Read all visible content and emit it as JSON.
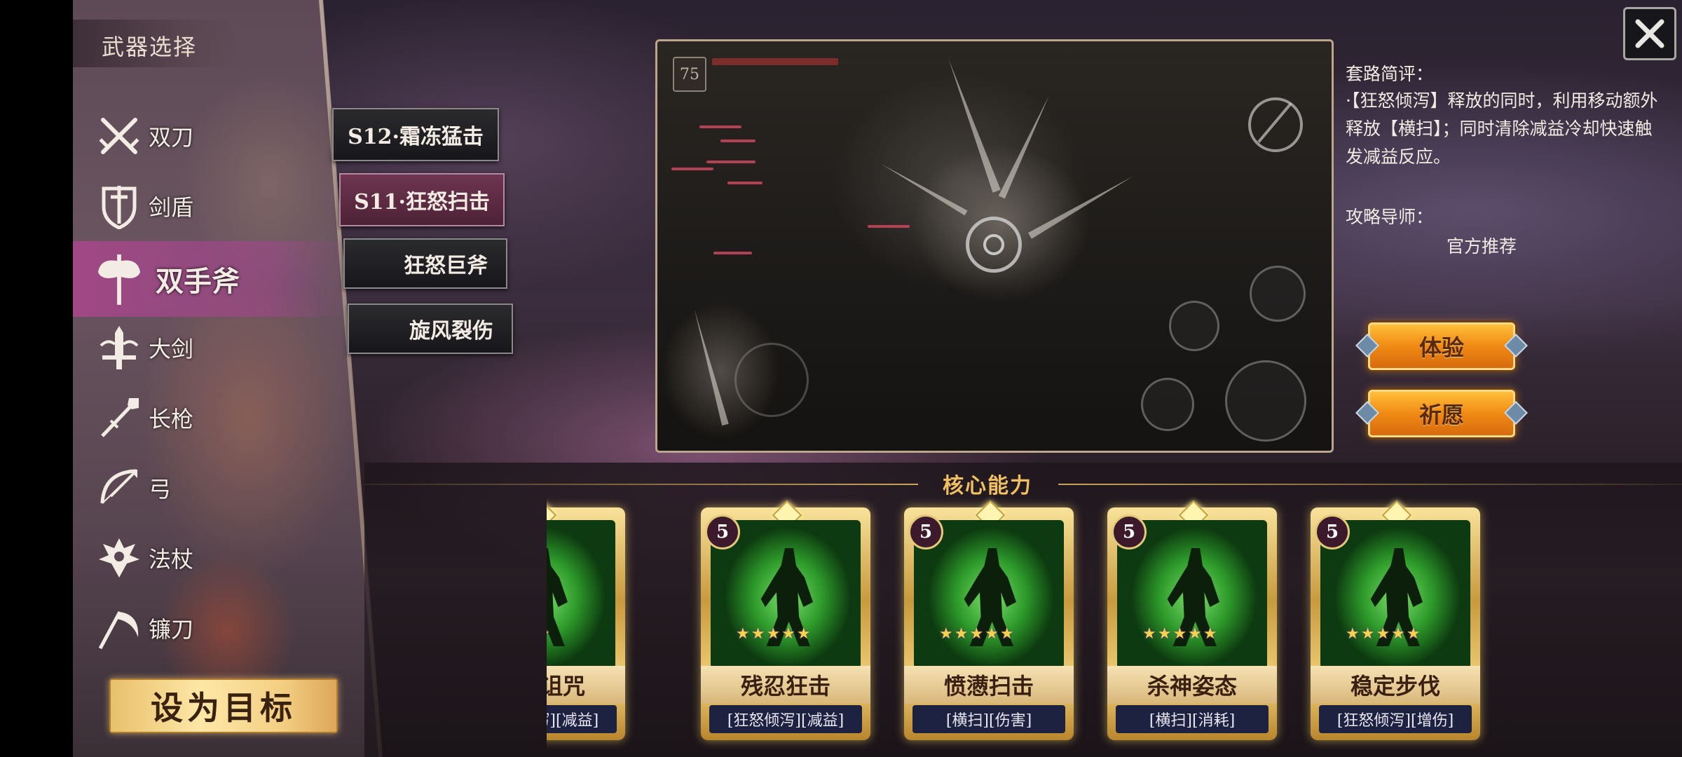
{
  "panel": {
    "title": "武器选择"
  },
  "weapons": [
    {
      "label": "双刀",
      "icon": "dual-blades-icon"
    },
    {
      "label": "剑盾",
      "icon": "sword-shield-icon"
    },
    {
      "label": "双手斧",
      "icon": "two-handed-axe-icon"
    },
    {
      "label": "大剑",
      "icon": "greatsword-icon"
    },
    {
      "label": "长枪",
      "icon": "spear-icon"
    },
    {
      "label": "弓",
      "icon": "bow-icon"
    },
    {
      "label": "法杖",
      "icon": "staff-icon"
    },
    {
      "label": "镰刀",
      "icon": "scythe-icon"
    }
  ],
  "selected_weapon": "双手斧",
  "set_target_label": "设为目标",
  "skill_tabs": [
    {
      "label": "S12·霜冻猛击"
    },
    {
      "label": "S11·狂怒扫击"
    },
    {
      "label": "狂怒巨斧"
    },
    {
      "label": "旋风裂伤"
    }
  ],
  "selected_tab": "S11·狂怒扫击",
  "preview": {
    "level": "75"
  },
  "info": {
    "review_title": "套路简评：",
    "review_text": "·【狂怒倾泻】释放的同时，利用移动额外释放【横扫】；同时清除减益冷却快速触发减益反应。",
    "mentor_title": "攻略导师：",
    "mentor_name": "官方推荐"
  },
  "buttons": {
    "experience": "体验",
    "pray": "祈愿"
  },
  "core": {
    "title": "核心能力",
    "cards": [
      {
        "name": "狂怒诅咒",
        "tags": "[狂怒倾泻][减益]",
        "level": "",
        "stars": "★★★★"
      },
      {
        "name": "残忍狂击",
        "tags": "[狂怒倾泻][减益]",
        "level": "5",
        "stars": "★★★★★"
      },
      {
        "name": "愤懑扫击",
        "tags": "[横扫][伤害]",
        "level": "5",
        "stars": "★★★★★"
      },
      {
        "name": "杀神姿态",
        "tags": "[横扫][消耗]",
        "level": "5",
        "stars": "★★★★★"
      },
      {
        "name": "稳定步伐",
        "tags": "[狂怒倾泻][增伤]",
        "level": "5",
        "stars": "★★★★★"
      }
    ]
  },
  "colors": {
    "active_weapon": "#a8468c",
    "gold": "#f0c060",
    "button_orange": "#f08a14"
  }
}
